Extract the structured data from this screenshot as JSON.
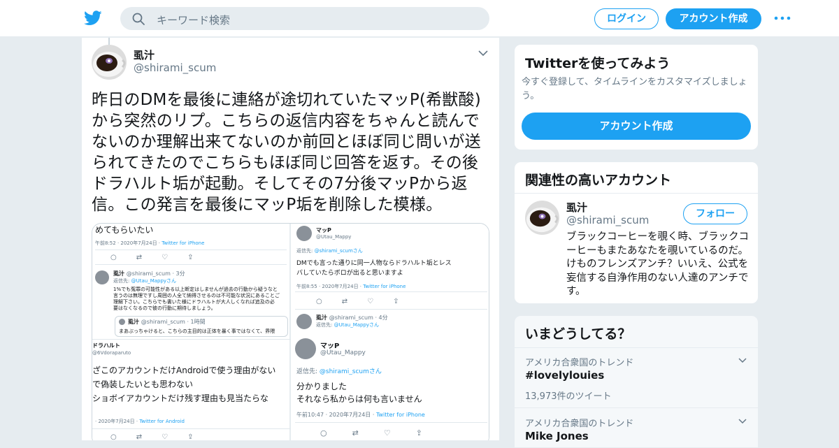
{
  "brand": {
    "accent": "#1da1f2"
  },
  "header": {
    "search_placeholder": "キーワード検索",
    "login_label": "ログイン",
    "signup_label": "アカウント作成"
  },
  "tweet": {
    "author_name": "虱汁",
    "author_handle": "@shirami_scum",
    "text": "昨日のDMを最後に連絡が途切れていたマッP(希獣酸)から突然のリプ。こちらの返信内容をちゃんと読んでないのか理解出来てないのか前回とほぼ同じ問いが送られてきたのでこちらもほぼ同じ回答を返す。その後ドラハルト垢が起動。そしてその7分後マッPから返信。この発言を最後にマッP垢を削除した模様。",
    "media": {
      "left": {
        "top_text": "めてもらいたい",
        "time1": "午前8:52 · 2020年7月24日 · ",
        "via1": "Twitter for iPhone",
        "reply_name": "虱汁",
        "reply_meta": "@shirami_scum · 3分",
        "reply_to_prefix": "返信先: ",
        "reply_to": "@Utau_Mappyさん",
        "reply_body": [
          "1%でも冤罪の可能性がある以上断定はしませんが過去の行動から疑うなと",
          "言うのは無理ですし周囲の人全て納得させるのは不可能な状況にあることご",
          "理解下さい。こちらでも書いた様にドラハルトが大人しくなれば追及の必",
          "要はなくなるので彼の行動に期待しましょう。"
        ],
        "quote_name": "虱汁",
        "quote_meta": "@shirami_scum · 1時間",
        "quote_body": "まあぶっちゃけると、こちらの主目的は正体を暴く事ではなくて、界隈",
        "dora_name": "ドラハルト",
        "dora_handle": "@6Vdoraparuto",
        "dora_body": [
          "ざこのアカウントだけAndroidで使う理由がない",
          "で偽装したいとも思わない",
          "ショボイアカウントだけ残す理由も見当たらな"
        ],
        "dora_time": "· 2020年7月24日 · ",
        "dora_via": "Twitter for Android"
      },
      "right": {
        "name1": "マッP",
        "handle1": "@Utau_Mappy",
        "reply_to_prefix1": "返信先: ",
        "reply_to1": "@shirami_scumさん",
        "body1": [
          "DMでも言った通りに同一人物ならドラハルト垢とレス",
          "バしていたらボロが出ると思いますよ"
        ],
        "time1": "午前8:55 · 2020年7月24日 · ",
        "via1": "Twitter for iPhone",
        "name2": "虱汁",
        "meta2": "@shirami_scum · 4分",
        "reply_to_prefix2": "返信先: ",
        "reply_to2": "@Utau_Mappyさん",
        "name3": "マッP",
        "handle3": "@Utau_Mappy",
        "reply_to_prefix3": "返信先: ",
        "reply_to3": "@shirami_scumさん",
        "body3": [
          "分かりました",
          "それなら私からは何も言いません"
        ],
        "time3": "午前10:47 · 2020年7月24日 · ",
        "via3": "Twitter for iPhone"
      }
    }
  },
  "sidebar": {
    "try_twitter": {
      "title": "Twitterを使ってみよう",
      "desc": "今すぐ登録して、タイムラインをカスタマイズしましょう。",
      "button": "アカウント作成"
    },
    "related": {
      "title": "関連性の高いアカウント",
      "name": "虱汁",
      "handle": "@shirami_scum",
      "follow": "フォロー",
      "bio": "ブラックコーヒーを覗く時、ブラックコーヒーもまたあなたを覗いているのだ。 けものフレンズアンチ？いいえ、公式を妄信する自浄作用のない人達のアンチです。"
    },
    "trends": {
      "title": "いまどうしてる？",
      "items": [
        {
          "context": "アメリカ合衆国のトレンド",
          "name": "#lovelylouies",
          "count": "13,973件のツイート"
        },
        {
          "context": "アメリカ合衆国のトレンド",
          "name": "Mike Jones"
        }
      ]
    }
  }
}
